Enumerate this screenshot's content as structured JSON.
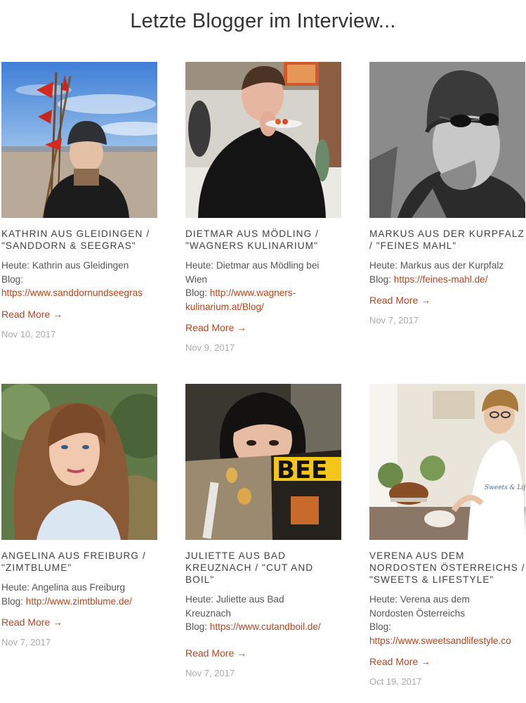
{
  "page": {
    "title": "Letzte Blogger im Interview..."
  },
  "posts": [
    {
      "title_lines": [
        "KATHRIN AUS GLEIDINGEN /",
        "\"SANDDORN & SEEGRAS\""
      ],
      "lines": [
        {
          "text": "Heute: Kathrin aus Gleidingen"
        },
        {
          "text": "Blog:"
        },
        {
          "link": "https://www.sanddornundseegras"
        }
      ],
      "read_more": "Read More →",
      "date": "Nov 10, 2017",
      "photo": "woman-beanie-beach-with-red-flags"
    },
    {
      "title_lines": [
        "DIETMAR AUS MÖDLING /",
        "\"WAGNERS KULINARIUM\""
      ],
      "lines": [
        {
          "text": "Heute: Dietmar aus Mödling bei"
        },
        {
          "text": "Wien"
        },
        {
          "prefix": "Blog: ",
          "link": "http://www.wagners-"
        },
        {
          "link": "kulinarium.at/Blog/"
        }
      ],
      "read_more": "Read More →",
      "date": "Nov 9, 2017",
      "photo": "man-tasting-food-at-event"
    },
    {
      "title_lines": [
        "MARKUS AUS DER KURPFALZ",
        "/ \"FEINES MAHL\""
      ],
      "lines": [
        {
          "text": "Heute: Markus aus der Kurpfalz"
        },
        {
          "prefix": "Blog: ",
          "link": "https://feines-mahl.de/"
        }
      ],
      "read_more": "Read More →",
      "date": "Nov 7, 2017",
      "photo": "man-beanie-sunglasses-bw"
    },
    {
      "title_lines": [
        "ANGELINA AUS FREIBURG /",
        "\"ZIMTBLUME\""
      ],
      "lines": [
        {
          "text": "Heute: Angelina aus Freiburg"
        },
        {
          "prefix": "Blog: ",
          "link": "http://www.zimtblume.de/"
        }
      ],
      "read_more": "Read More →",
      "date": "Nov 7, 2017",
      "photo": "woman-long-hair-portrait"
    },
    {
      "title_lines": [
        "JULIETTE AUS BAD",
        "KREUZNACH / \"CUT AND",
        "BOIL\""
      ],
      "lines": [
        {
          "text": "Heute: Juliette aus Bad"
        },
        {
          "text": "Kreuznach"
        },
        {
          "prefix": "Blog: ",
          "link": "https://www.cutandboil.de/"
        }
      ],
      "read_more": "Read More →",
      "date": "Nov 7, 2017",
      "photo": "woman-behind-beef-magazine",
      "magazine_text": "BEE"
    },
    {
      "title_lines": [
        "VERENA AUS DEM",
        "NORDOSTEN ÖSTERREICHS /",
        "\"SWEETS & LIFESTYLE\""
      ],
      "lines": [
        {
          "text": "Heute: Verena aus dem"
        },
        {
          "text": "Nordosten Österreichs"
        },
        {
          "text": "Blog:"
        },
        {
          "link": "https://www.sweetsandlifestyle.co"
        }
      ],
      "read_more": "Read More →",
      "date": "Oct 19, 2017",
      "photo": "woman-baking-in-kitchen",
      "apron_text": "Sweets & Lifestyle"
    }
  ],
  "colors": {
    "accent": "#c0431a",
    "title": "#333333",
    "date": "#aaaaaa"
  }
}
